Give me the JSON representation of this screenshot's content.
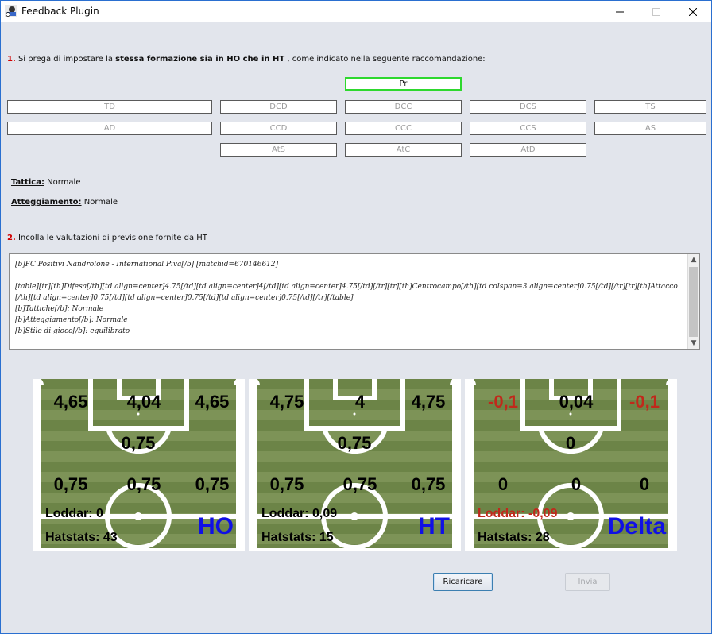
{
  "window": {
    "title": "Feedback Plugin"
  },
  "step1": {
    "number": "1.",
    "pre": "Si prega di impostare la",
    "bold": "stessa formazione sia in HO che in HT",
    "post": ", come indicato nella seguente raccomandazione:"
  },
  "positions": {
    "keeper": "Pr",
    "row1": [
      "TD",
      "DCD",
      "DCC",
      "DCS",
      "TS"
    ],
    "row2": [
      "AD",
      "CCD",
      "CCC",
      "CCS",
      "AS"
    ],
    "row3": [
      "AtS",
      "AtC",
      "AtD"
    ]
  },
  "tactic": {
    "label": "Tattica:",
    "value": "Normale"
  },
  "attitude": {
    "label": "Atteggiamento:",
    "value": "Normale"
  },
  "step2": {
    "number": "2.",
    "text": "Incolla le valutazioni di previsione fornite da HT"
  },
  "ht_input": {
    "value": "[b]FC Positivi Nandrolone - International Piva[/b] [matchid=670146612]\n\n[table][tr][th]Difesa[/th][td align=center]4.75[/td][td align=center]4[/td][td align=center]4.75[/td][/tr][tr][th]Centrocampo[/th][td colspan=3 align=center]0.75[/td][/tr][tr][th]Attacco[/th][td align=center]0.75[/td][td align=center]0.75[/td][td align=center]0.75[/td][/tr][/table]\n[b]Tattiche[/b]: Normale\n[b]Atteggiamento[/b]: Normale\n[b]Stile di gioco[/b]: equilibrato"
  },
  "fields": [
    {
      "name": "HO",
      "defense": [
        "4,65",
        "4,04",
        "4,65"
      ],
      "midfield": "0,75",
      "attack": [
        "0,75",
        "0,75",
        "0,75"
      ],
      "loddar": "Loddar: 0",
      "hatstats": "Hatstats: 43"
    },
    {
      "name": "HT",
      "defense": [
        "4,75",
        "4",
        "4,75"
      ],
      "midfield": "0,75",
      "attack": [
        "0,75",
        "0,75",
        "0,75"
      ],
      "loddar": "Loddar: 0,09",
      "hatstats": "Hatstats: 15"
    },
    {
      "name": "Delta",
      "defense": [
        "-0,1",
        "0,04",
        "-0,1"
      ],
      "midfield": "0",
      "attack": [
        "0",
        "0",
        "0"
      ],
      "loddar": "Loddar: -0,09",
      "hatstats": "Hatstats: 28"
    }
  ],
  "buttons": {
    "reload": "Ricaricare",
    "send": "Invia"
  },
  "colors": {
    "active_border": "#2ed82e",
    "negative": "#c0291b",
    "field_title": "#1010e6",
    "step_number": "#d00000"
  }
}
